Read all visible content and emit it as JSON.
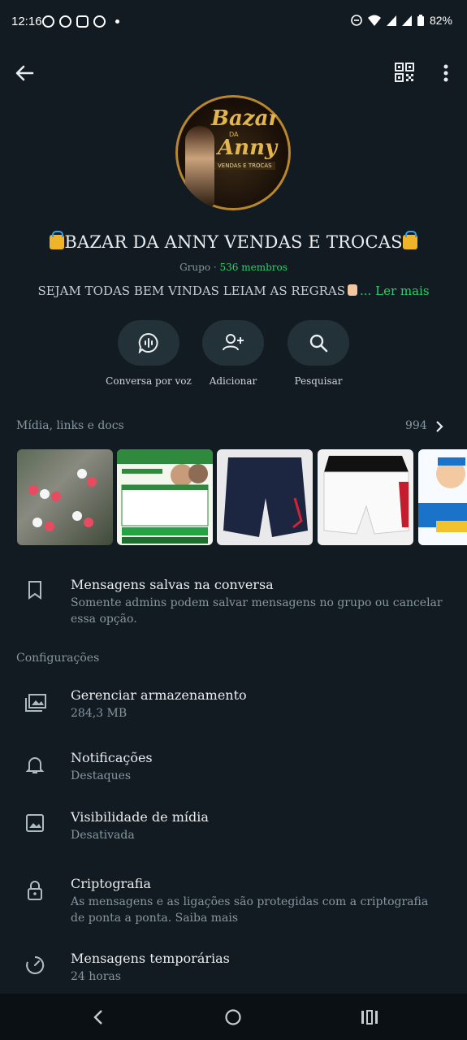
{
  "status_bar": {
    "time": "12:16",
    "battery": "82%"
  },
  "header": {
    "back_icon": "arrow-left-icon",
    "qr_icon": "qr-code-icon",
    "menu_icon": "more-vert-icon"
  },
  "group": {
    "avatar_text_1": "Bazar",
    "avatar_text_2": "DA",
    "avatar_text_3": "Anny",
    "avatar_text_4": "VENDAS E TROCAS",
    "title": "BAZAR DA ANNY VENDAS E TROCAS",
    "type": "Grupo · ",
    "members": "536 membros",
    "description": "SEJAM TODAS BEM VINDAS LEIAM AS REGRAS",
    "description_more": "... Ler mais"
  },
  "actions": [
    {
      "label": "Conversa por voz",
      "icon": "voice-chat-icon"
    },
    {
      "label": "Adicionar",
      "icon": "add-person-icon"
    },
    {
      "label": "Pesquisar",
      "icon": "search-icon"
    }
  ],
  "media": {
    "header": "Mídia, links e docs",
    "count": "994"
  },
  "saved": {
    "title": "Mensagens salvas na conversa",
    "subtitle": "Somente admins podem salvar mensagens no grupo ou cancelar essa opção."
  },
  "settings": {
    "section_label": "Configurações",
    "items": [
      {
        "title": "Gerenciar armazenamento",
        "subtitle": "284,3 MB",
        "icon": "storage-icon"
      },
      {
        "title": "Notificações",
        "subtitle": "Destaques",
        "icon": "bell-icon"
      },
      {
        "title": "Visibilidade de mídia",
        "subtitle": "Desativada",
        "icon": "image-icon"
      },
      {
        "title": "Criptografia",
        "subtitle": "As mensagens e as ligações são protegidas com a criptografia de ponta a ponta. Saiba mais",
        "icon": "lock-icon"
      },
      {
        "title": "Mensagens temporárias",
        "subtitle": "24 horas",
        "icon": "timer-icon"
      }
    ]
  },
  "colors": {
    "background": "#121b22",
    "accent": "#25d366",
    "button_bg": "#233138"
  }
}
